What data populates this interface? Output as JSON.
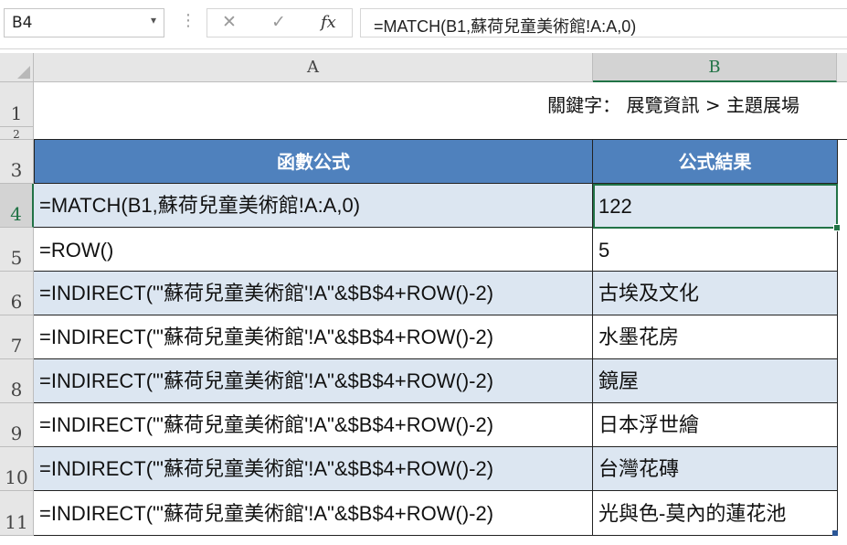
{
  "formula_bar": {
    "name_box": "B4",
    "name_box_arrow": "▾",
    "separator": "⋮",
    "cancel_symbol": "✕",
    "enter_symbol": "✓",
    "fx_label": "fx",
    "formula": "=MATCH(B1,蘇荷兒童美術館!A:A,0)"
  },
  "columns": [
    "A",
    "B"
  ],
  "rows": [
    "1",
    "2",
    "3",
    "4",
    "5",
    "6",
    "7",
    "8",
    "9",
    "10",
    "11"
  ],
  "keyword_line": "關鍵字：  展覽資訊 > 主題展場",
  "table": {
    "headers": [
      "函數公式",
      "公式結果"
    ],
    "rows": [
      {
        "formula": "=MATCH(B1,蘇荷兒童美術館!A:A,0)",
        "result": "122"
      },
      {
        "formula": "=ROW()",
        "result": "5"
      },
      {
        "formula": "=INDIRECT(\"'蘇荷兒童美術館'!A\"&$B$4+ROW()-2)",
        "result": "古埃及文化"
      },
      {
        "formula": "=INDIRECT(\"'蘇荷兒童美術館'!A\"&$B$4+ROW()-2)",
        "result": "水墨花房"
      },
      {
        "formula": "=INDIRECT(\"'蘇荷兒童美術館'!A\"&$B$4+ROW()-2)",
        "result": "鏡屋"
      },
      {
        "formula": "=INDIRECT(\"'蘇荷兒童美術館'!A\"&$B$4+ROW()-2)",
        "result": "日本浮世繪"
      },
      {
        "formula": "=INDIRECT(\"'蘇荷兒童美術館'!A\"&$B$4+ROW()-2)",
        "result": "台灣花磚"
      },
      {
        "formula": "=INDIRECT(\"'蘇荷兒童美術館'!A\"&$B$4+ROW()-2)",
        "result": "光與色-莫內的蓮花池"
      }
    ]
  },
  "active_cell": "B4",
  "colors": {
    "header_fill": "#4f81bd",
    "band_fill": "#dce6f1",
    "selection": "#217346"
  }
}
